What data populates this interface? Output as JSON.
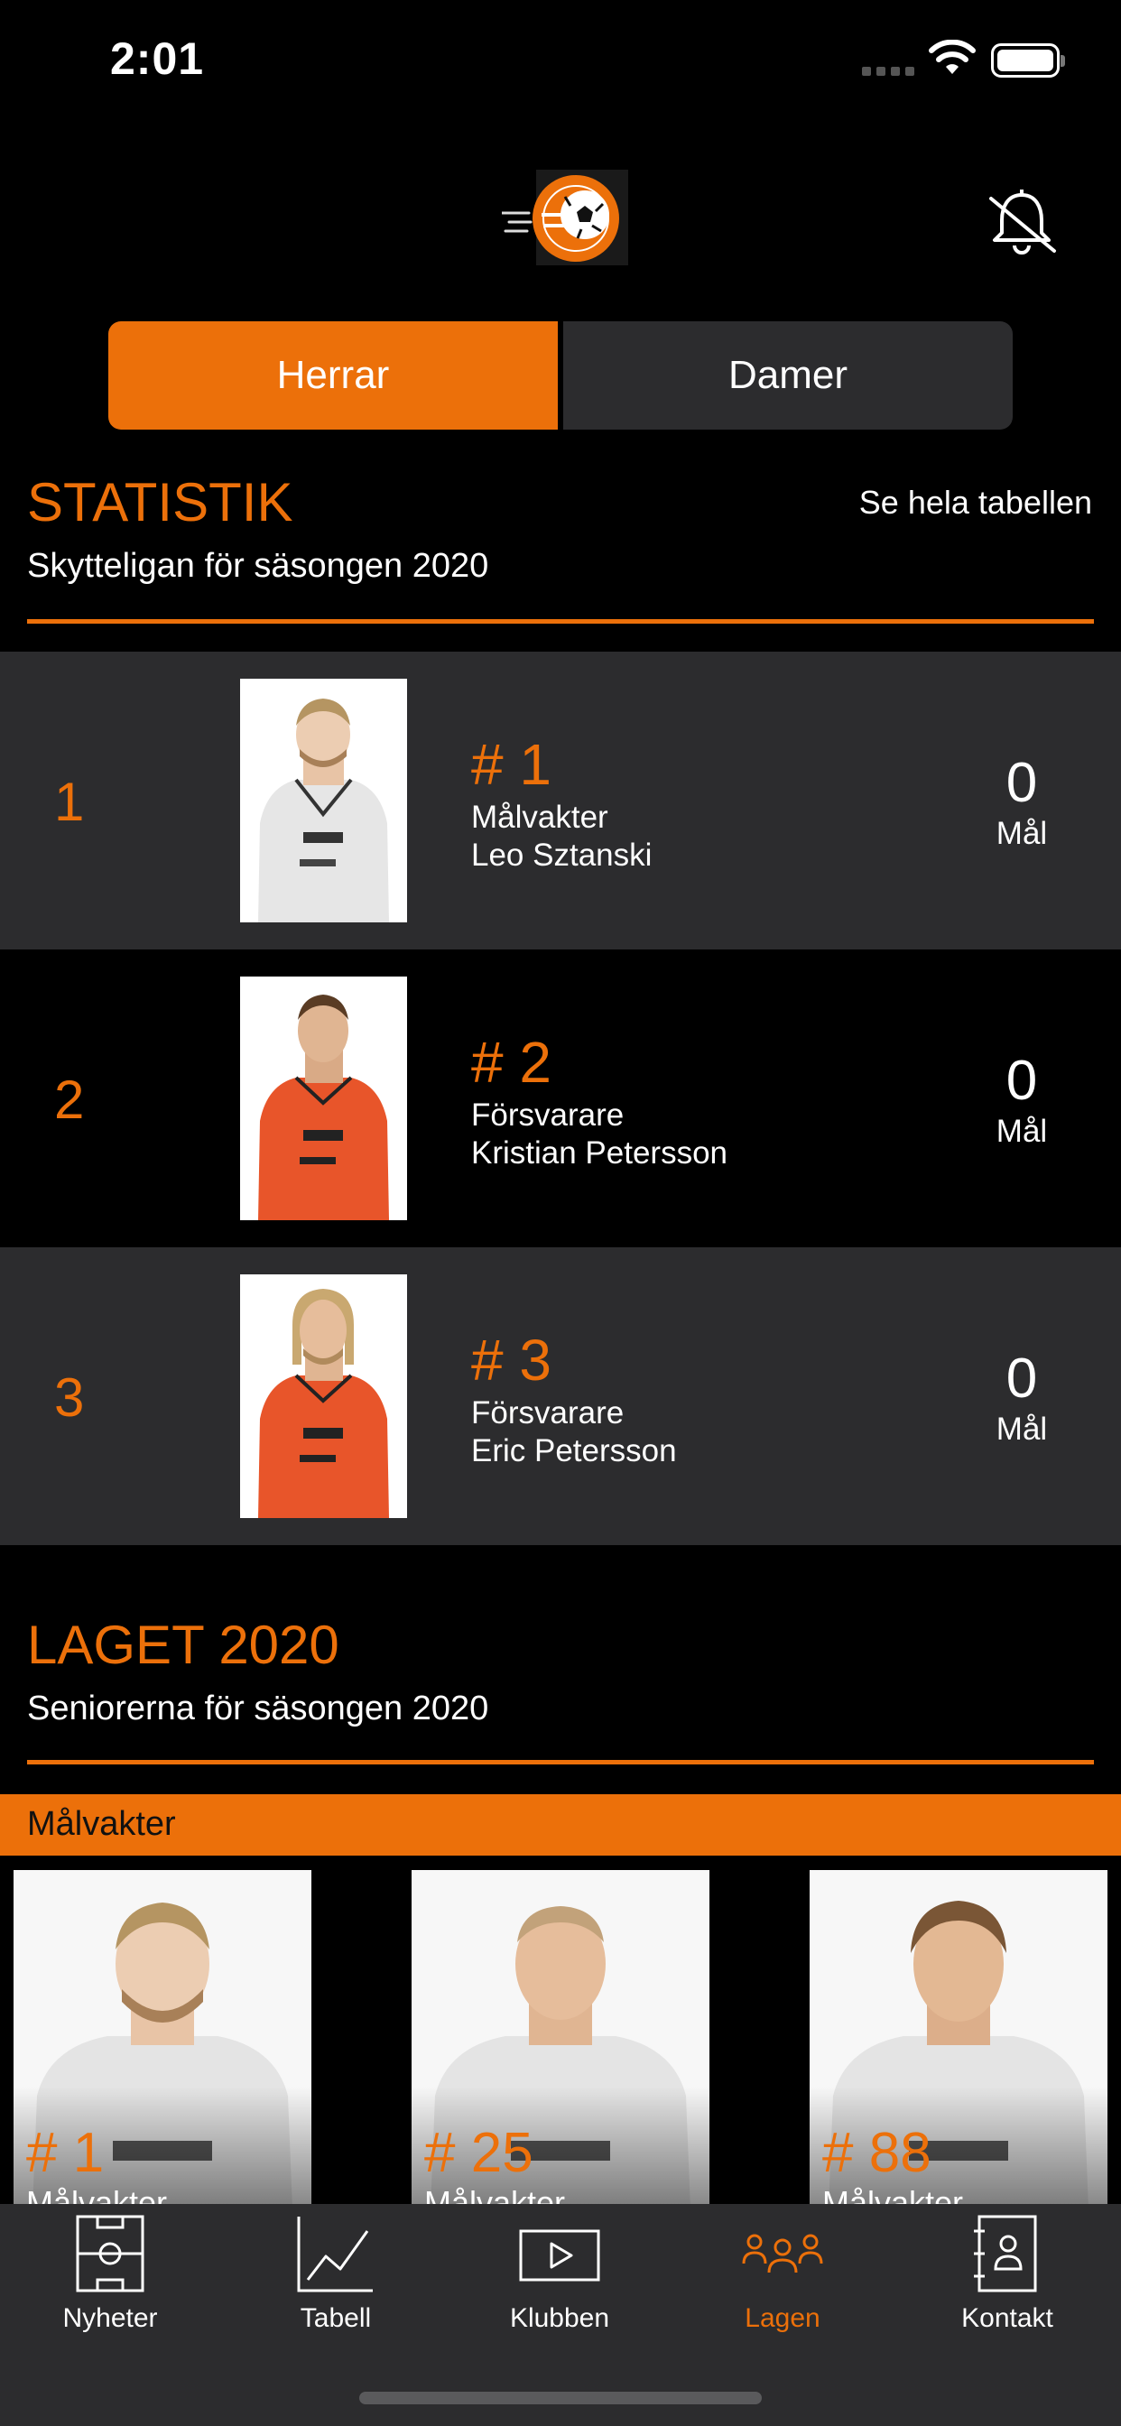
{
  "status": {
    "time": "2:01"
  },
  "toggle": {
    "left": "Herrar",
    "right": "Damer",
    "active": "left"
  },
  "statistik": {
    "title": "STATISTIK",
    "subtitle": "Skytteligan för säsongen 2020",
    "link": "Se hela tabellen",
    "rows": [
      {
        "rank": "1",
        "number": "# 1",
        "position": "Målvakter",
        "name": "Leo Sztanski",
        "goals": "0",
        "goals_label": "Mål",
        "shirt": "white"
      },
      {
        "rank": "2",
        "number": "# 2",
        "position": "Försvarare",
        "name": "Kristian Petersson",
        "goals": "0",
        "goals_label": "Mål",
        "shirt": "orange"
      },
      {
        "rank": "3",
        "number": "# 3",
        "position": "Försvarare",
        "name": "Eric Petersson",
        "goals": "0",
        "goals_label": "Mål",
        "shirt": "orange"
      }
    ]
  },
  "laget": {
    "title": "LAGET 2020",
    "subtitle": "Seniorerna för säsongen 2020",
    "category": "Målvakter",
    "cards": [
      {
        "number": "# 1",
        "position": "Målvakter"
      },
      {
        "number": "# 25",
        "position": "Målvakter"
      },
      {
        "number": "# 88",
        "position": "Målvakter"
      }
    ]
  },
  "tabs": [
    {
      "label": "Nyheter",
      "icon": "pitch-icon"
    },
    {
      "label": "Tabell",
      "icon": "chart-icon"
    },
    {
      "label": "Klubben",
      "icon": "play-icon"
    },
    {
      "label": "Lagen",
      "icon": "team-icon",
      "active": true
    },
    {
      "label": "Kontakt",
      "icon": "contact-book-icon"
    }
  ],
  "colors": {
    "accent": "#ec700a",
    "row_dark": "#2c2c2e",
    "background": "#000000"
  }
}
